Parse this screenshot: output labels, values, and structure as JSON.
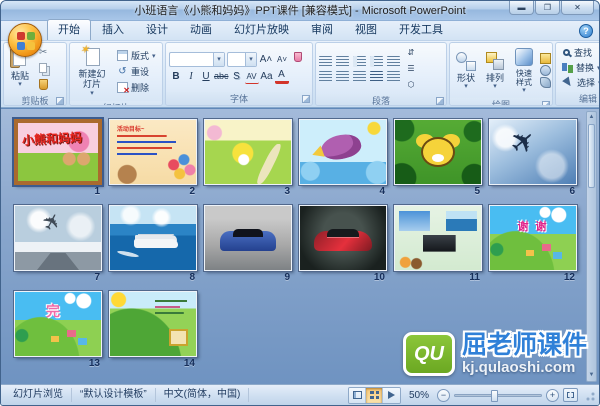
{
  "window": {
    "title": "小班语言《小熊和妈妈》PPT课件 [兼容模式] - Microsoft PowerPoint",
    "minimize": "▬",
    "maximize": "❐",
    "close": "✕",
    "help": "?"
  },
  "ribbon": {
    "tabs": [
      "开始",
      "插入",
      "设计",
      "动画",
      "幻灯片放映",
      "审阅",
      "视图",
      "开发工具"
    ],
    "clipboard": {
      "group": "剪贴板",
      "paste": "粘贴"
    },
    "slides_group": {
      "group": "幻灯片",
      "new_slide": "新建幻灯片",
      "layout": "版式",
      "reset": "重设",
      "del": "删除"
    },
    "font": {
      "group": "字体",
      "bold": "B",
      "italic": "I",
      "underline": "U",
      "strike": "abc",
      "shadow": "S",
      "spacing": "AV",
      "case": "Aa",
      "color": "A"
    },
    "paragraph": {
      "group": "段落"
    },
    "drawing": {
      "group": "绘图",
      "shapes": "形状",
      "arrange": "排列",
      "quick_styles": "快速样式"
    },
    "editing": {
      "group": "编辑",
      "find": "查找",
      "replace": "替换",
      "select": "选择"
    }
  },
  "slides": [
    {
      "num": "1",
      "text": "小熊和妈妈",
      "selected": true
    },
    {
      "num": "2",
      "text": "活动目标~"
    },
    {
      "num": "3"
    },
    {
      "num": "4"
    },
    {
      "num": "5"
    },
    {
      "num": "6"
    },
    {
      "num": "7"
    },
    {
      "num": "8"
    },
    {
      "num": "9"
    },
    {
      "num": "10"
    },
    {
      "num": "11"
    },
    {
      "num": "12",
      "text": "谢 谢"
    },
    {
      "num": "13",
      "text": "完"
    },
    {
      "num": "14"
    }
  ],
  "watermark": {
    "logo": "QU",
    "brand": "屈老师课件",
    "url": "kj.qulaoshi.com",
    "brand_color": "#2f80d8",
    "logo_color": "#7cb829"
  },
  "status": {
    "view_mode": "幻灯片浏览",
    "design_template": "“默认设计模板”",
    "language": "中文(简体，中国)",
    "zoom_level": "50%"
  }
}
